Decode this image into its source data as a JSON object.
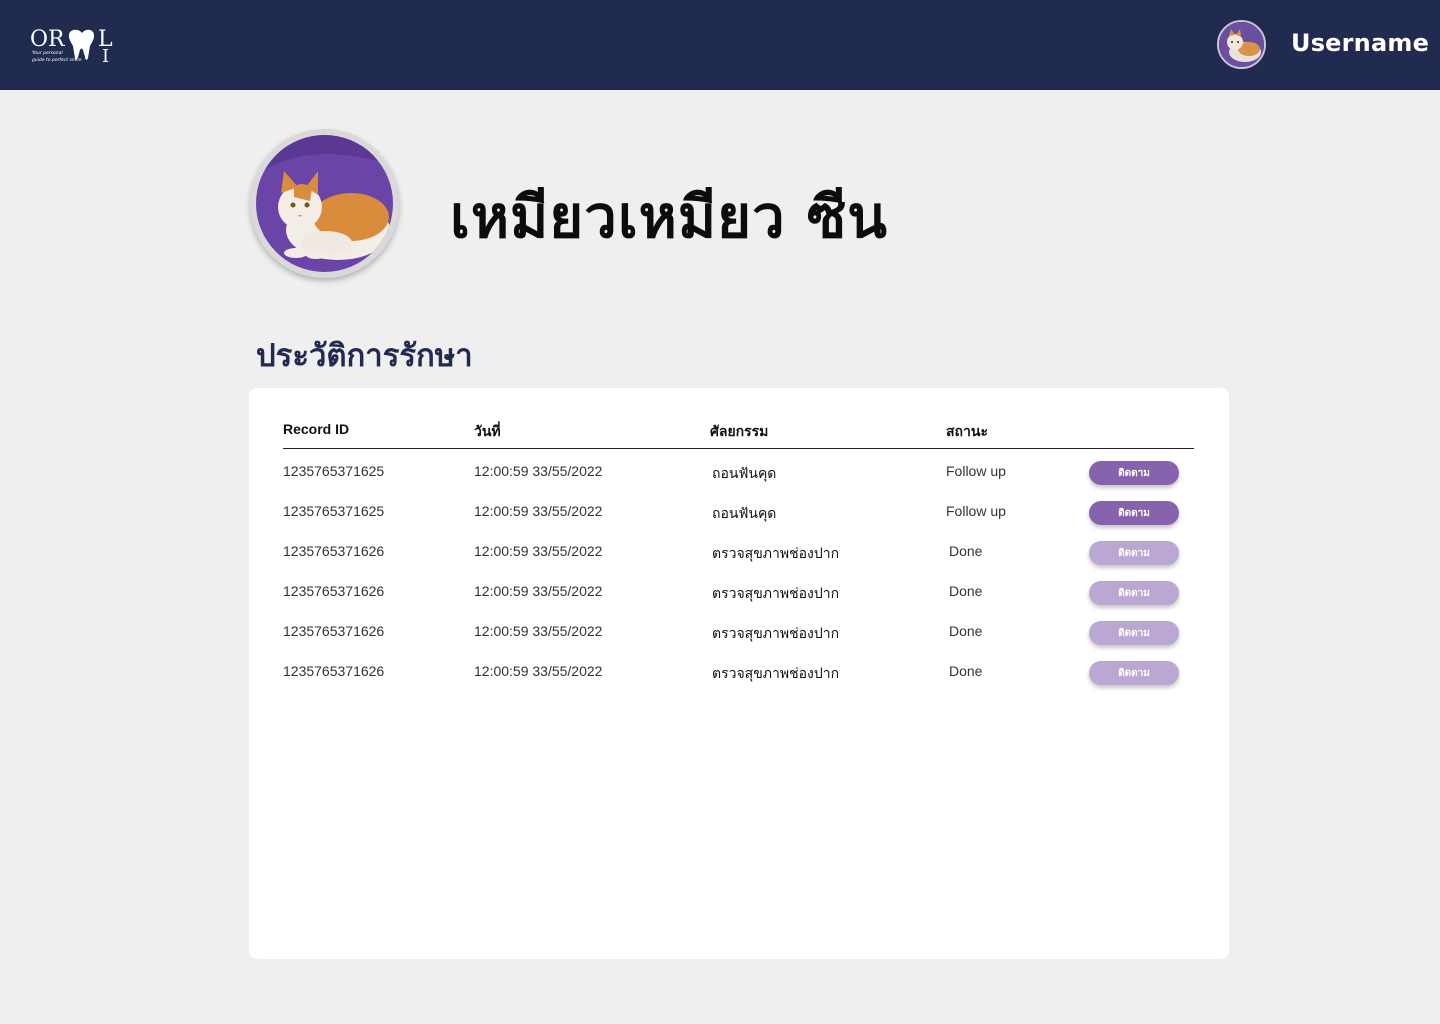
{
  "header": {
    "logo_text": "ORAL",
    "logo_tagline": "Your personal guide to perfect smile",
    "username": "Username"
  },
  "profile": {
    "name": "เหมียวเหมียว ซีน"
  },
  "history": {
    "title": "ประวัติการรักษา",
    "columns": [
      "Record ID",
      "วันที่",
      "ศัลยกรรม",
      "สถานะ"
    ],
    "rows": [
      {
        "record_id": "1235765371625",
        "date": "12:00:59  33/55/2022",
        "procedure": "ถอนฟันคุด",
        "status": "Follow up",
        "action": "ติดตาม",
        "action_state": "active"
      },
      {
        "record_id": "1235765371625",
        "date": "12:00:59  33/55/2022",
        "procedure": "ถอนฟันคุด",
        "status": "Follow up",
        "action": "ติดตาม",
        "action_state": "active"
      },
      {
        "record_id": "1235765371626",
        "date": "12:00:59  33/55/2022",
        "procedure": "ตรวจสุขภาพช่องปาก",
        "status": "Done",
        "action": "ติดตาม",
        "action_state": "muted"
      },
      {
        "record_id": "1235765371626",
        "date": "12:00:59  33/55/2022",
        "procedure": "ตรวจสุขภาพช่องปาก",
        "status": "Done",
        "action": "ติดตาม",
        "action_state": "muted"
      },
      {
        "record_id": "1235765371626",
        "date": "12:00:59  33/55/2022",
        "procedure": "ตรวจสุขภาพช่องปาก",
        "status": "Done",
        "action": "ติดตาม",
        "action_state": "muted"
      },
      {
        "record_id": "1235765371626",
        "date": "12:00:59  33/55/2022",
        "procedure": "ตรวจสุขภาพช่องปาก",
        "status": "Done",
        "action": "ติดตาม",
        "action_state": "muted"
      }
    ]
  },
  "colors": {
    "header_bg": "#212a4f",
    "button_active": "#8762ad",
    "button_muted": "#bba7d4"
  }
}
